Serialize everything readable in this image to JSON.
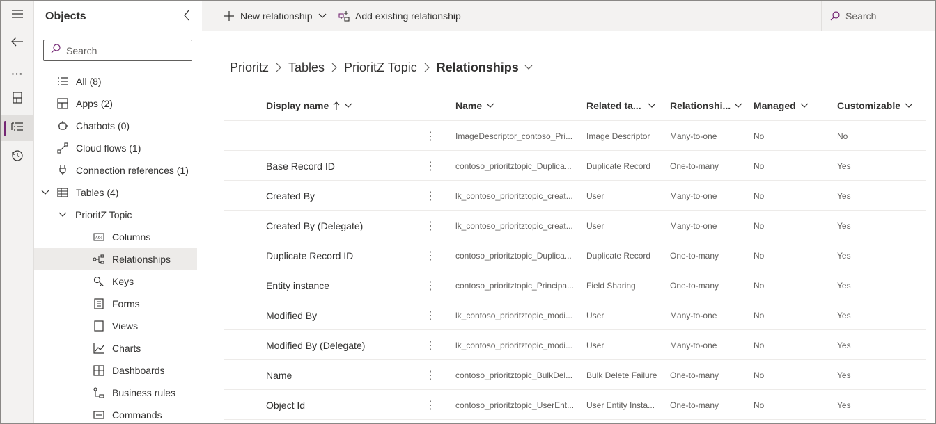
{
  "panel": {
    "title": "Objects",
    "search_placeholder": "Search",
    "items": [
      {
        "label": "All",
        "count": "(8)",
        "icon": "list-icon"
      },
      {
        "label": "Apps",
        "count": "(2)",
        "icon": "apps-icon"
      },
      {
        "label": "Chatbots",
        "count": "(0)",
        "icon": "chatbot-icon"
      },
      {
        "label": "Cloud flows",
        "count": "(1)",
        "icon": "flow-icon"
      },
      {
        "label": "Connection references",
        "count": "(1)",
        "icon": "plug-icon"
      },
      {
        "label": "Tables",
        "count": "(4)",
        "icon": "table-icon"
      },
      {
        "label": "PrioritZ Topic"
      },
      {
        "label": "Columns",
        "icon": "columns-icon"
      },
      {
        "label": "Relationships",
        "icon": "relationships-icon"
      },
      {
        "label": "Keys",
        "icon": "key-icon"
      },
      {
        "label": "Forms",
        "icon": "form-icon"
      },
      {
        "label": "Views",
        "icon": "view-icon"
      },
      {
        "label": "Charts",
        "icon": "chart-icon"
      },
      {
        "label": "Dashboards",
        "icon": "dashboard-icon"
      },
      {
        "label": "Business rules",
        "icon": "business-rules-icon"
      },
      {
        "label": "Commands",
        "icon": "commands-icon"
      }
    ]
  },
  "toolbar": {
    "new_relationship": "New relationship",
    "add_existing": "Add existing relationship",
    "search_placeholder": "Search"
  },
  "breadcrumb": [
    "Prioritz",
    "Tables",
    "PrioritZ Topic",
    "Relationships"
  ],
  "table": {
    "columns": [
      "Display name",
      "Name",
      "Related ta...",
      "Relationshi...",
      "Managed",
      "Customizable"
    ],
    "rows": [
      {
        "display": "",
        "name": "ImageDescriptor_contoso_Pri...",
        "related": "Image Descriptor",
        "type": "Many-to-one",
        "managed": "No",
        "customizable": "No"
      },
      {
        "display": "Base Record ID",
        "name": "contoso_prioritztopic_Duplica...",
        "related": "Duplicate Record",
        "type": "One-to-many",
        "managed": "No",
        "customizable": "Yes"
      },
      {
        "display": "Created By",
        "name": "lk_contoso_prioritztopic_creat...",
        "related": "User",
        "type": "Many-to-one",
        "managed": "No",
        "customizable": "Yes"
      },
      {
        "display": "Created By (Delegate)",
        "name": "lk_contoso_prioritztopic_creat...",
        "related": "User",
        "type": "Many-to-one",
        "managed": "No",
        "customizable": "Yes"
      },
      {
        "display": "Duplicate Record ID",
        "name": "contoso_prioritztopic_Duplica...",
        "related": "Duplicate Record",
        "type": "One-to-many",
        "managed": "No",
        "customizable": "Yes"
      },
      {
        "display": "Entity instance",
        "name": "contoso_prioritztopic_Principa...",
        "related": "Field Sharing",
        "type": "One-to-many",
        "managed": "No",
        "customizable": "Yes"
      },
      {
        "display": "Modified By",
        "name": "lk_contoso_prioritztopic_modi...",
        "related": "User",
        "type": "Many-to-one",
        "managed": "No",
        "customizable": "Yes"
      },
      {
        "display": "Modified By (Delegate)",
        "name": "lk_contoso_prioritztopic_modi...",
        "related": "User",
        "type": "Many-to-one",
        "managed": "No",
        "customizable": "Yes"
      },
      {
        "display": "Name",
        "name": "contoso_prioritztopic_BulkDel...",
        "related": "Bulk Delete Failure",
        "type": "One-to-many",
        "managed": "No",
        "customizable": "Yes"
      },
      {
        "display": "Object Id",
        "name": "contoso_prioritztopic_UserEnt...",
        "related": "User Entity Insta...",
        "type": "One-to-many",
        "managed": "No",
        "customizable": "Yes"
      }
    ]
  },
  "colors": {
    "accent": "#742774",
    "rail_bg": "#f3f2f1",
    "selected_bg": "#edebe9"
  }
}
